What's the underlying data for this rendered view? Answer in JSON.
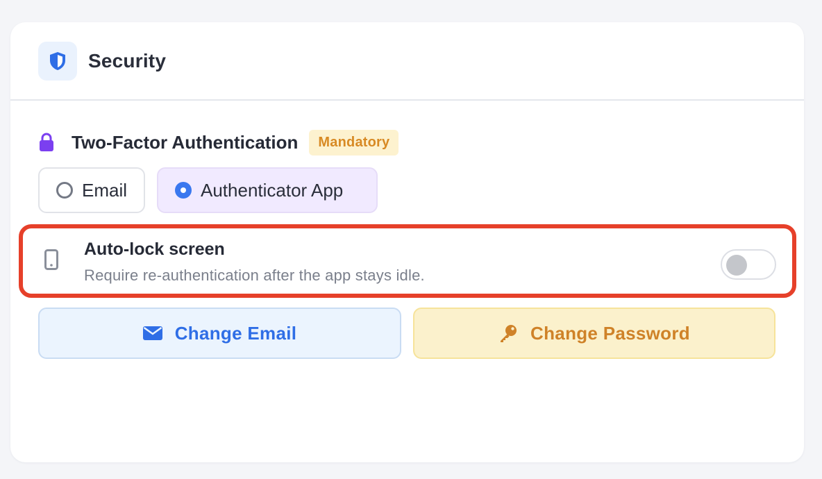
{
  "card": {
    "title": "Security",
    "icon": "shield-icon"
  },
  "two_factor": {
    "icon": "lock-icon",
    "title": "Two-Factor Authentication",
    "badge": "Mandatory",
    "options": [
      {
        "label": "Email",
        "selected": false
      },
      {
        "label": "Authenticator App",
        "selected": true
      }
    ]
  },
  "auto_lock": {
    "icon": "phone-icon",
    "title": "Auto-lock screen",
    "description": "Require re-authentication after the app stays idle.",
    "enabled": false,
    "highlighted": true
  },
  "actions": {
    "change_email": {
      "label": "Change Email",
      "icon": "envelope-icon"
    },
    "change_password": {
      "label": "Change Password",
      "icon": "key-icon"
    }
  },
  "colors": {
    "accent_blue": "#3a78ef",
    "badge_text": "#d88a24",
    "badge_bg": "#fdf2cf",
    "lock_purple": "#7b3ff0",
    "highlight_red": "#e6402a",
    "password_orange": "#cf8228"
  }
}
